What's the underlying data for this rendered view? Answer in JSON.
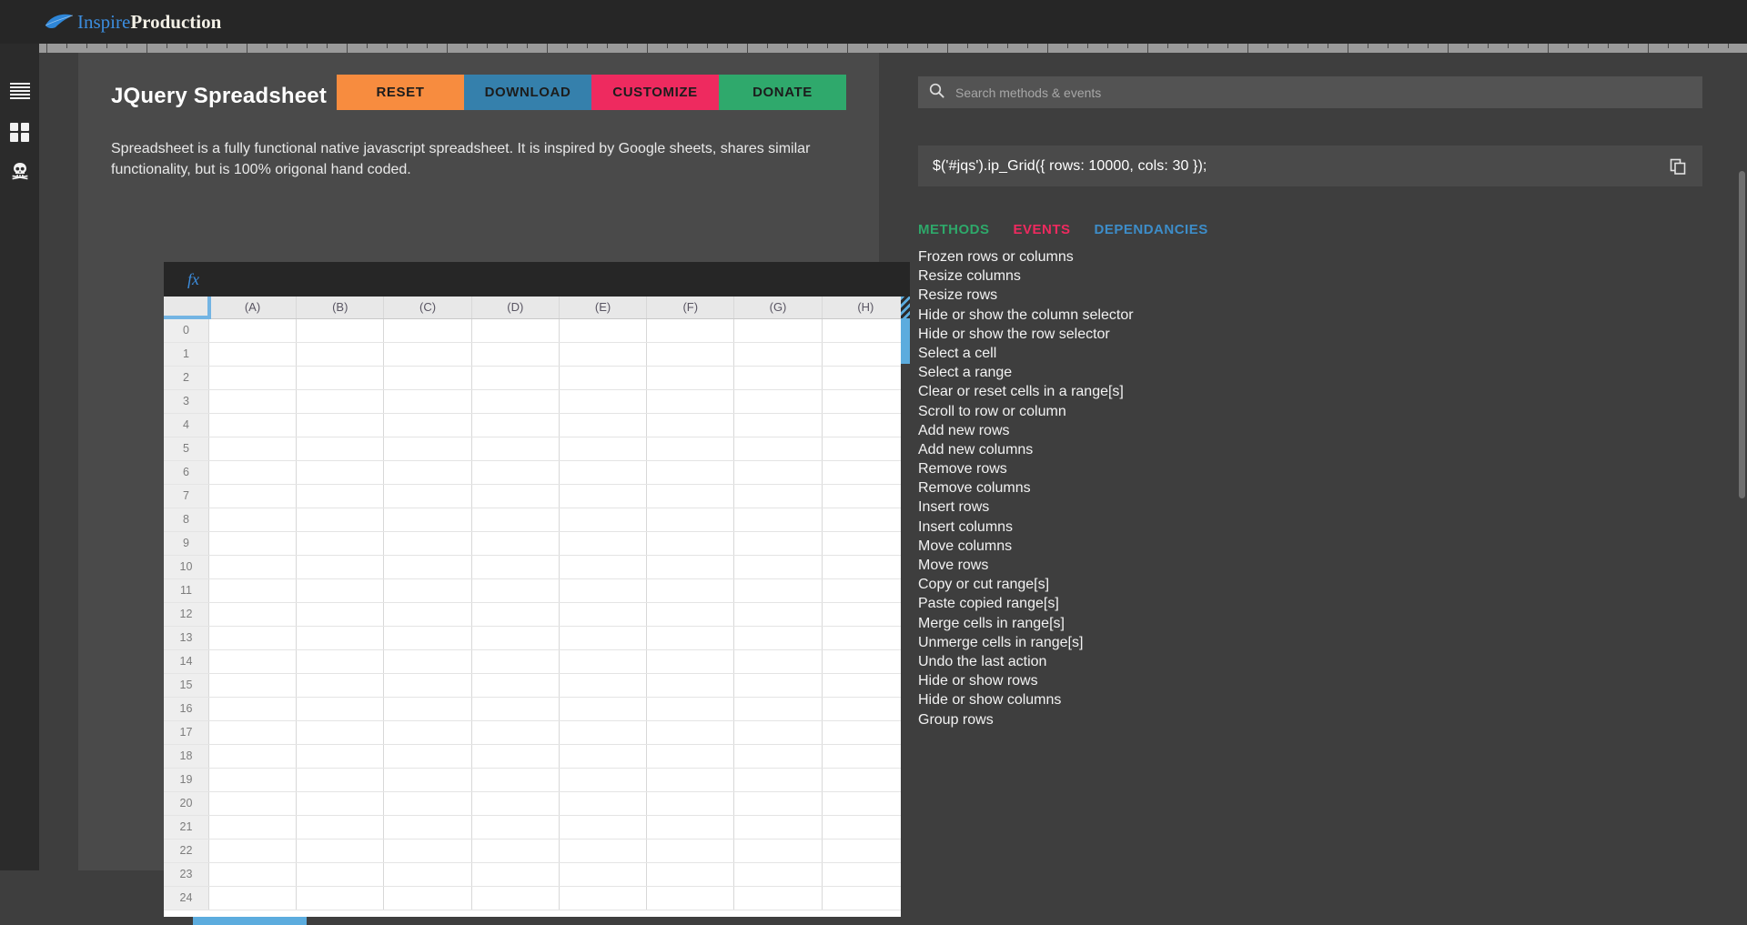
{
  "brand": {
    "part1": "Inspire",
    "part2": "Production",
    "leaf_icon": "leaf-icon"
  },
  "rail": {
    "items": [
      {
        "icon": "menu-lines-icon",
        "name": "menu"
      },
      {
        "icon": "grid-squares-icon",
        "name": "apps"
      },
      {
        "icon": "skull-crossbones-icon",
        "name": "skull"
      }
    ]
  },
  "card": {
    "title": "JQuery Spreadsheet",
    "description": "Spreadsheet is a fully functional native javascript spreadsheet. It is inspired by Google sheets, shares similar functionality, but is 100% origonal hand coded.",
    "buttons": [
      {
        "label": "RESET",
        "color": "#f78c3f"
      },
      {
        "label": "DOWNLOAD",
        "color": "#3580ac"
      },
      {
        "label": "CUSTOMIZE",
        "color": "#ee2a5f"
      },
      {
        "label": "DONATE",
        "color": "#2fa96c"
      }
    ]
  },
  "sheet": {
    "fx_label": "fx",
    "columns": [
      "(A)",
      "(B)",
      "(C)",
      "(D)",
      "(E)",
      "(F)",
      "(G)",
      "(H)"
    ],
    "rows": [
      "0",
      "1",
      "2",
      "3",
      "4",
      "5",
      "6",
      "7",
      "8",
      "9",
      "10",
      "11",
      "12",
      "13",
      "14",
      "15",
      "16",
      "17",
      "18",
      "19",
      "20",
      "21",
      "22",
      "23",
      "24"
    ],
    "accent_color": "#5cacde"
  },
  "search": {
    "placeholder": "Search methods & events",
    "value": "",
    "icon": "search-icon"
  },
  "code": {
    "snippet": "$('#jqs').ip_Grid({ rows: 10000, cols: 30 });",
    "copy_icon": "copy-icon"
  },
  "tabs": [
    {
      "label": "METHODS",
      "color": "#2ea86a"
    },
    {
      "label": "EVENTS",
      "color": "#ee2a5f"
    },
    {
      "label": "DEPENDANCIES",
      "color": "#3d8dc9"
    }
  ],
  "methods": [
    "Frozen rows or columns",
    "Resize columns",
    "Resize rows",
    "Hide or show the column selector",
    "Hide or show the row selector",
    "Select a cell",
    "Select a range",
    "Clear or reset cells in a range[s]",
    "Scroll to row or column",
    "Add new rows",
    "Add new columns",
    "Remove rows",
    "Remove columns",
    "Insert rows",
    "Insert columns",
    "Move columns",
    "Move rows",
    "Copy or cut range[s]",
    "Paste copied range[s]",
    "Merge cells in range[s]",
    "Unmerge cells in range[s]",
    "Undo the last action",
    "Hide or show rows",
    "Hide or show columns",
    "Group rows"
  ]
}
